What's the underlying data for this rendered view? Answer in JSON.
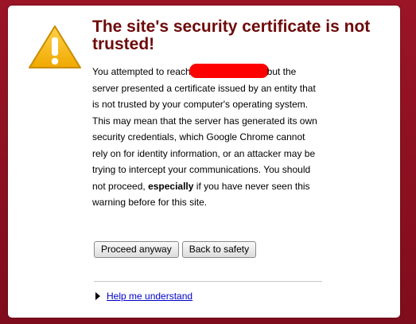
{
  "interstitial": {
    "title": "The site's security certificate is not trusted!",
    "message_part1": "You attempted to reach",
    "message_part2": "but the server presented a certificate issued by an entity that is not trusted by your computer's operating system. This may mean that the server has generated its own security credentials, which Google Chrome cannot rely on for identity information, or an attacker may be trying to intercept your communications. You should not proceed,",
    "message_emphasis": "especially",
    "message_part3": "if you have never seen this warning before for this site.",
    "buttons": {
      "proceed_label": "Proceed anyway",
      "back_label": "Back to safety"
    },
    "help_link": "Help me understand",
    "icons": {
      "warning": "warning-triangle-icon",
      "expand": "expand-triangle-icon"
    }
  },
  "colors": {
    "background": "#8e1022",
    "title": "#6e0a0a",
    "link": "#0000cc",
    "redaction": "#ff0000",
    "warning_fill": "#f5b800"
  }
}
